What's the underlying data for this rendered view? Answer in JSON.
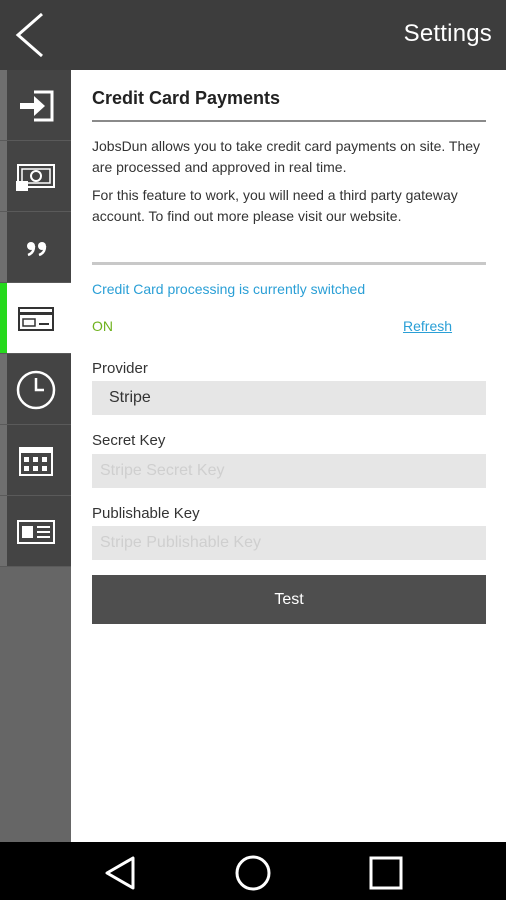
{
  "header": {
    "title": "Settings",
    "back_icon": "chevron-left-icon"
  },
  "sidebar": {
    "items": [
      {
        "icon": "sign-in-icon",
        "active": false
      },
      {
        "icon": "money-icon",
        "active": false
      },
      {
        "icon": "quote-icon",
        "active": false
      },
      {
        "icon": "credit-card-icon",
        "active": true
      },
      {
        "icon": "clock-icon",
        "active": false
      },
      {
        "icon": "calendar-icon",
        "active": false
      },
      {
        "icon": "id-card-icon",
        "active": false
      }
    ],
    "active_color": "#25d91d"
  },
  "main": {
    "title": "Credit Card Payments",
    "description_1": "JobsDun allows you to take credit card payments on site. They are processed and approved in real time.",
    "description_2": "For this feature to work, you will need a third party gateway account. To find out more please visit our website.",
    "status_text": "Credit Card processing is currently switched",
    "status_value": "ON",
    "refresh_label": "Refresh",
    "provider": {
      "label": "Provider",
      "value": "Stripe"
    },
    "secret_key": {
      "label": "Secret Key",
      "value": "",
      "placeholder": "Stripe Secret Key"
    },
    "publishable_key": {
      "label": "Publishable Key",
      "value": "",
      "placeholder": "Stripe Publishable Key"
    },
    "test_label": "Test"
  },
  "system_nav": {
    "icons": [
      "back-triangle-icon",
      "home-circle-icon",
      "recents-square-icon"
    ]
  },
  "colors": {
    "topbar": "#3d3d3d",
    "link": "#2a9fd6",
    "on": "#6fb21e",
    "button": "#4e4e4e"
  }
}
